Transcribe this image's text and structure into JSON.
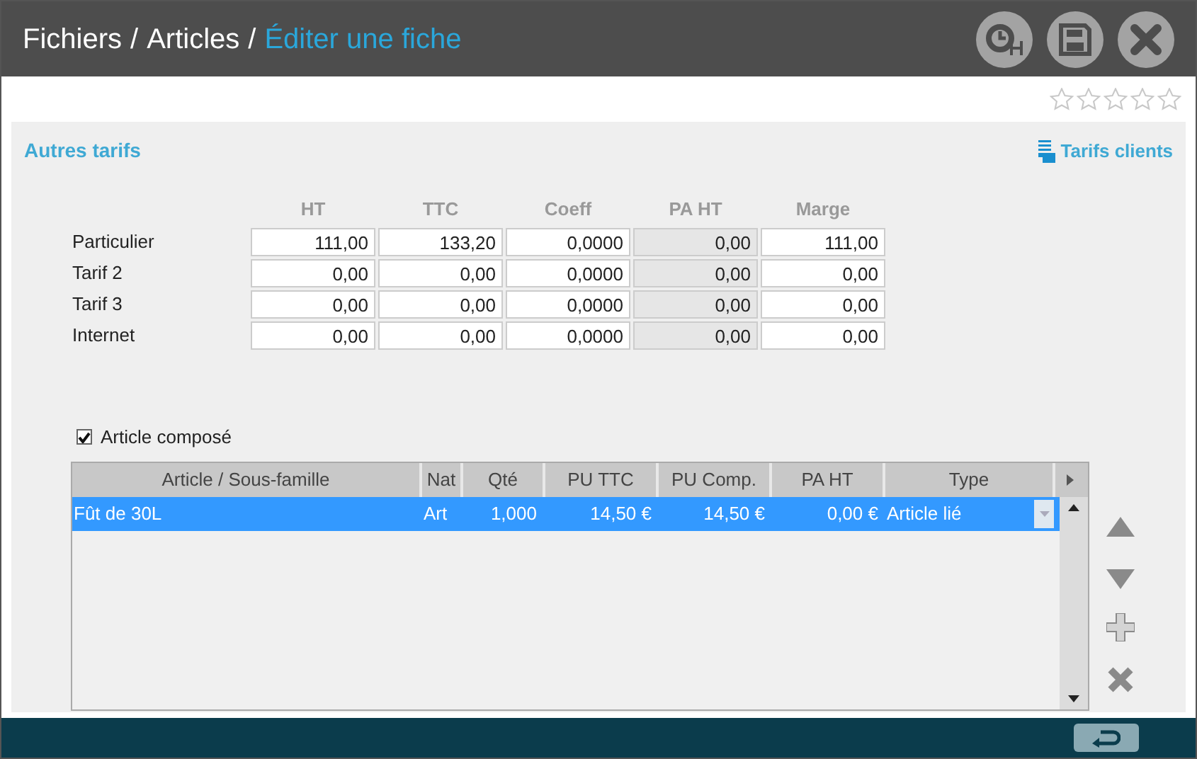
{
  "breadcrumb": {
    "separator": "/",
    "items": [
      {
        "label": "Fichiers",
        "current": false
      },
      {
        "label": "Articles",
        "current": false
      },
      {
        "label": "Éditer une fiche",
        "current": true
      }
    ]
  },
  "rating": {
    "stars": 0
  },
  "section": {
    "title": "Autres tarifs",
    "link": "Tarifs clients"
  },
  "prices": {
    "columns": [
      {
        "label": "HT",
        "readonly": false
      },
      {
        "label": "TTC",
        "readonly": false
      },
      {
        "label": "Coeff",
        "readonly": false
      },
      {
        "label": "PA HT",
        "readonly": true
      },
      {
        "label": "Marge",
        "readonly": false
      }
    ],
    "rows": [
      {
        "label": "Particulier",
        "values": [
          "111,00",
          "133,20",
          "0,0000",
          "0,00",
          "111,00"
        ]
      },
      {
        "label": "Tarif 2",
        "values": [
          "0,00",
          "0,00",
          "0,0000",
          "0,00",
          "0,00"
        ]
      },
      {
        "label": "Tarif 3",
        "values": [
          "0,00",
          "0,00",
          "0,0000",
          "0,00",
          "0,00"
        ]
      },
      {
        "label": "Internet",
        "values": [
          "0,00",
          "0,00",
          "0,0000",
          "0,00",
          "0,00"
        ]
      }
    ]
  },
  "composite": {
    "label": "Article composé",
    "checked": true
  },
  "grid": {
    "columns": [
      "Article / Sous-famille",
      "Nat",
      "Qté",
      "PU TTC",
      "PU Comp.",
      "PA HT",
      "Type"
    ],
    "rows": [
      {
        "selected": true,
        "cells": [
          "Fût de 30L",
          "Art",
          "1,000",
          "14,50 €",
          "14,50 €",
          "0,00 €",
          "Article lié"
        ]
      }
    ]
  }
}
